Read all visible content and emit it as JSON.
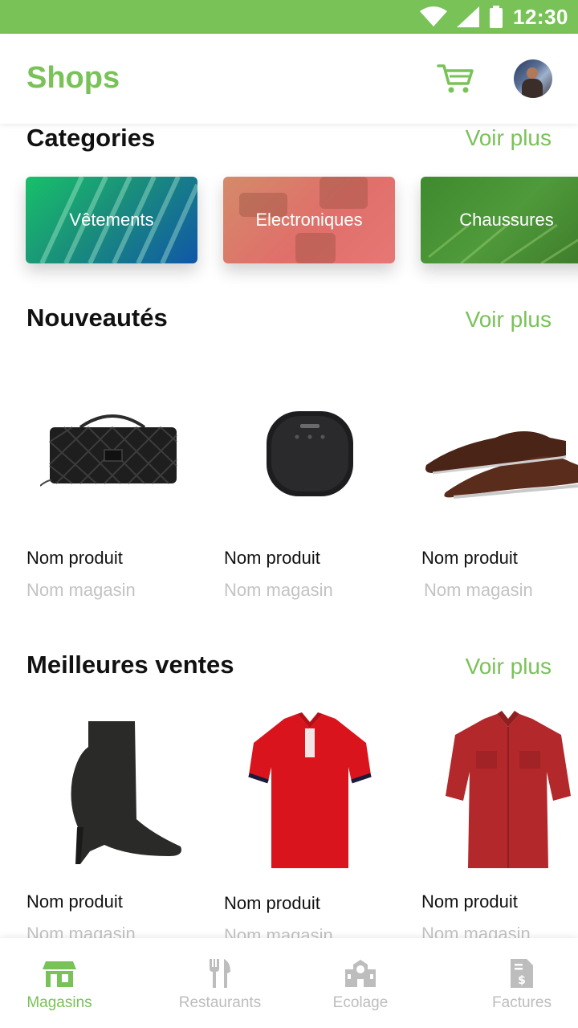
{
  "status_bar": {
    "time": "12:30",
    "color": "#79c258"
  },
  "header": {
    "title": "Shops",
    "cart_icon": "cart-icon",
    "avatar_icon": "user-avatar"
  },
  "categories": {
    "title": "Categories",
    "see_more": "Voir plus",
    "items": [
      {
        "label": "Vêtements"
      },
      {
        "label": "Electroniques"
      },
      {
        "label": "Chaussures"
      }
    ]
  },
  "new_arrivals": {
    "title": "Nouveautés",
    "see_more": "Voir plus",
    "items": [
      {
        "name": "Nom produit",
        "shop": "Nom magasin",
        "image": "quilted-handbag"
      },
      {
        "name": "Nom produit",
        "shop": "Nom magasin",
        "image": "bluetooth-speaker"
      },
      {
        "name": "Nom produit",
        "shop": "Nom magasin",
        "image": "leather-shoes"
      }
    ]
  },
  "best_sellers": {
    "title": "Meilleures ventes",
    "see_more": "Voir plus",
    "items": [
      {
        "name": "Nom produit",
        "shop": "Nom magasin",
        "image": "high-heel-boot"
      },
      {
        "name": "Nom produit",
        "shop": "Nom magasin",
        "image": "red-polo-shirt"
      },
      {
        "name": "Nom produit",
        "shop": "Nom magasin",
        "image": "red-shirt"
      }
    ]
  },
  "bottom_nav": {
    "items": [
      {
        "label": "Magasins",
        "icon": "store-icon",
        "active": true
      },
      {
        "label": "Restaurants",
        "icon": "fork-knife-icon",
        "active": false
      },
      {
        "label": "Ecolage",
        "icon": "school-icon",
        "active": false
      },
      {
        "label": "Factures",
        "icon": "invoice-icon",
        "active": false
      }
    ]
  },
  "colors": {
    "accent": "#79c258",
    "muted": "#bdbdbd"
  }
}
